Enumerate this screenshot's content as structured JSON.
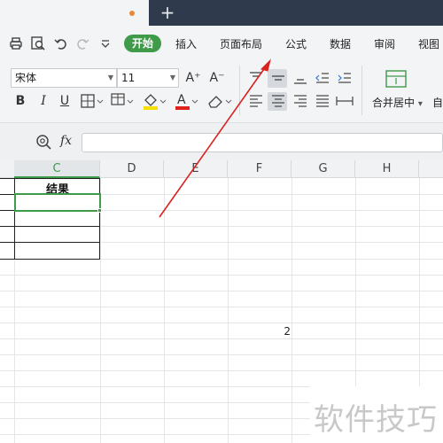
{
  "tabbar": {
    "add_icon": "plus-icon",
    "add_glyph": "+",
    "modified_dot_color": "#e8893b"
  },
  "quick_access": [
    "print-icon",
    "print-preview-icon",
    "undo-icon",
    "redo-icon",
    "customize-dropdown-icon"
  ],
  "menu": {
    "active": "开始",
    "items": [
      "插入",
      "页面布局",
      "公式",
      "数据",
      "审阅",
      "视图"
    ]
  },
  "ribbon": {
    "font_name": "宋体",
    "font_size": "11",
    "bold": "B",
    "italic": "I",
    "underline": "U",
    "increase_font": "A⁺",
    "decrease_font": "A⁻",
    "merge_center_label": "合并居中",
    "merge_dropdown": "▾",
    "wrap_label_partial": "自",
    "icons": [
      "border-icon",
      "fill-color-icon",
      "font-color-icon",
      "clear-format-icon",
      "align-top-icon",
      "align-middle-icon",
      "align-bottom-icon",
      "indent-decrease-icon",
      "indent-increase-icon",
      "align-left-icon",
      "align-center-icon",
      "align-right-icon",
      "justify-icon",
      "distributed-icon",
      "merge-center-icon"
    ]
  },
  "formula_bar": {
    "zoom_icon": "find-icon",
    "fx": "fx",
    "value": ""
  },
  "grid": {
    "columns": [
      "C",
      "D",
      "E",
      "F",
      "G",
      "H"
    ],
    "header_cell": "结果",
    "value_cell": "2",
    "selection_color": "#3f9a4a"
  },
  "watermark": "软件技巧",
  "annotation_color": "#d9231f"
}
